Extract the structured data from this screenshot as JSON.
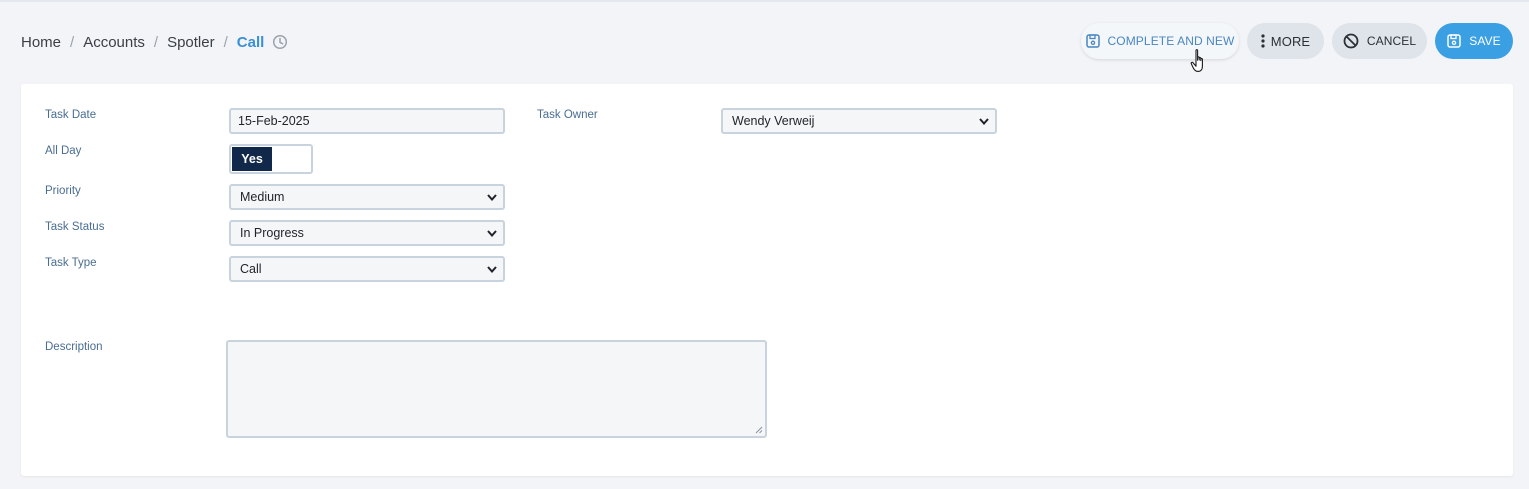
{
  "breadcrumb": {
    "items": [
      "Home",
      "Accounts",
      "Spotler"
    ],
    "separator": "/",
    "current": "Call",
    "history_icon": "clock-history-icon"
  },
  "toolbar": {
    "complete_new_label": "COMPLETE AND NEW",
    "more_label": "MORE",
    "cancel_label": "CANCEL",
    "save_label": "SAVE",
    "complete_new_icon": "floppy-disk-icon",
    "more_icon": "vertical-dots-icon",
    "cancel_icon": "prohibited-icon",
    "save_icon": "floppy-disk-icon"
  },
  "form": {
    "task_date": {
      "label": "Task Date",
      "value": "15-Feb-2025"
    },
    "task_owner": {
      "label": "Task Owner",
      "value": "Wendy Verweij"
    },
    "all_day": {
      "label": "All Day",
      "value": "Yes"
    },
    "priority": {
      "label": "Priority",
      "value": "Medium"
    },
    "task_status": {
      "label": "Task Status",
      "value": "In Progress"
    },
    "task_type": {
      "label": "Task Type",
      "value": "Call"
    },
    "description": {
      "label": "Description",
      "value": ""
    }
  },
  "colors": {
    "accent": "#3b9fe3",
    "toggle_on": "#12284a",
    "label": "#4a6d92"
  }
}
